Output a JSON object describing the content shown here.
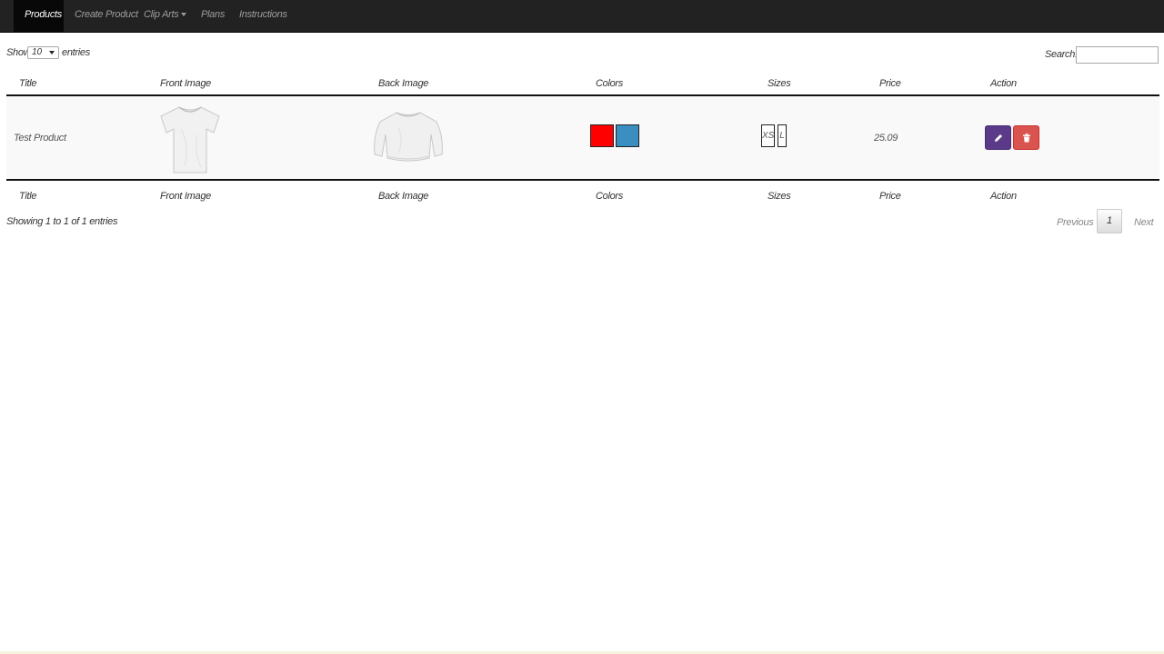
{
  "nav": {
    "items": [
      {
        "label": "Products",
        "active": true
      },
      {
        "label": "Create Product",
        "active": false
      },
      {
        "label": "Clip Arts",
        "active": false
      },
      {
        "label": "Plans",
        "active": false
      },
      {
        "label": "Instructions",
        "active": false
      }
    ]
  },
  "table_controls": {
    "show_label": "Show",
    "length_value": "10",
    "entries_label": "entries",
    "search_label": "Search:",
    "search_value": ""
  },
  "columns": [
    "Title",
    "Front Image",
    "Back Image",
    "Colors",
    "Sizes",
    "Price",
    "Action"
  ],
  "rows": [
    {
      "title": "Test Product",
      "front_image": "white-tshirt-image",
      "back_image": "white-sweatshirt-image",
      "colors": [
        "#ff0000",
        "#3a8fc0"
      ],
      "sizes": [
        "XS",
        "L"
      ],
      "price": "25.09"
    }
  ],
  "footer": {
    "info": "Showing 1 to 1 of 1 entries",
    "previous": "Previous",
    "page": "1",
    "next": "Next"
  },
  "colors": {
    "navbar": "#222222",
    "edit_button": "#5b3a8a",
    "delete_button": "#d9534f"
  }
}
